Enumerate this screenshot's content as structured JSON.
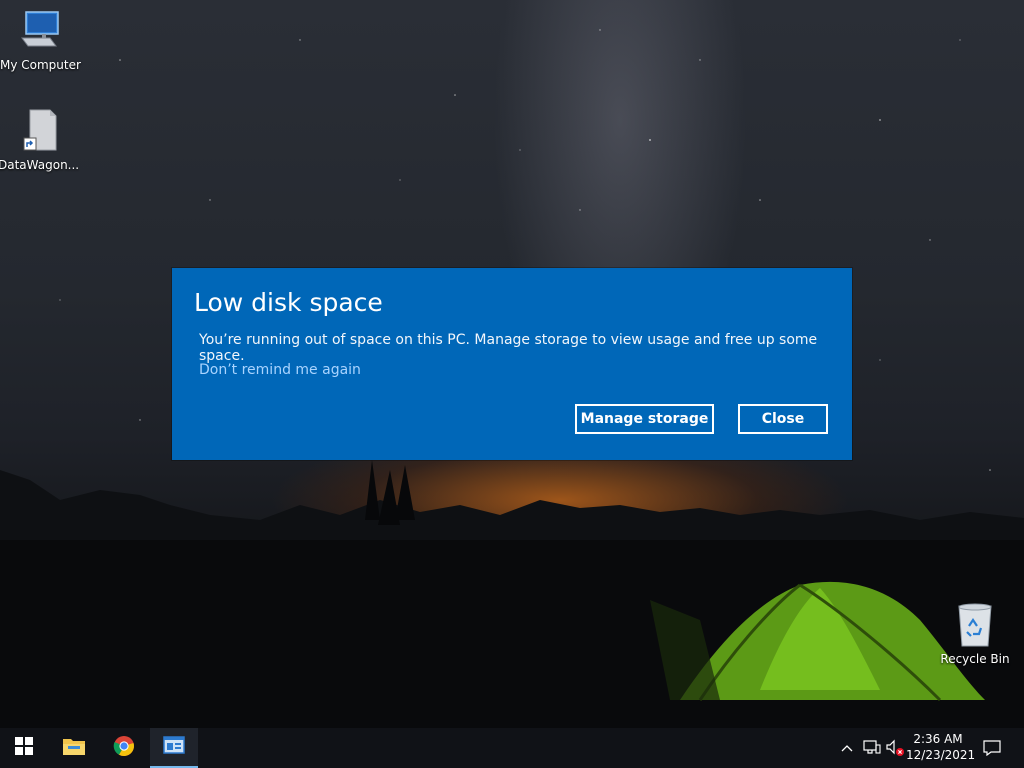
{
  "desktop": {
    "icons": [
      {
        "label": "My Computer",
        "icon": "monitor-icon"
      },
      {
        "label": "DataWagon...",
        "icon": "shortcut-file-icon"
      },
      {
        "label": "Recycle Bin",
        "icon": "recycle-bin-icon"
      }
    ]
  },
  "dialog": {
    "title": "Low disk space",
    "message": "You’re running out of space on this PC. Manage storage to view usage and free up some space.",
    "dismiss_link": "Don’t remind me again",
    "primary_button": "Manage storage",
    "secondary_button": "Close",
    "background_color": "#0067b8"
  },
  "taskbar": {
    "items": [
      {
        "name": "start",
        "icon": "windows-logo-icon"
      },
      {
        "name": "file-explorer",
        "icon": "folder-icon"
      },
      {
        "name": "chrome",
        "icon": "chrome-icon"
      },
      {
        "name": "app-window",
        "icon": "window-app-icon",
        "active": true
      }
    ],
    "tray": {
      "icons": [
        "chevron-up-icon",
        "network-icon",
        "volume-muted-icon",
        "notification-icon"
      ],
      "time": "2:36 AM",
      "date": "12/23/2021"
    }
  }
}
